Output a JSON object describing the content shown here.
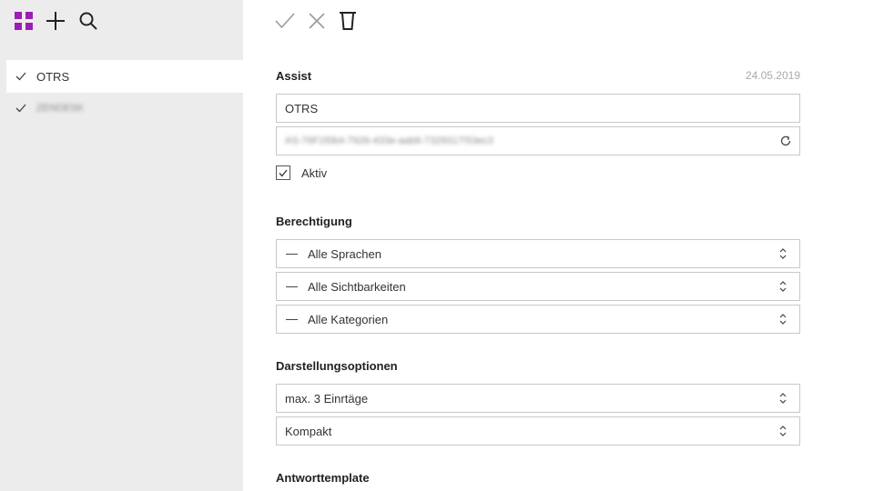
{
  "sidebar": {
    "items": [
      {
        "label": "OTRS",
        "active": true
      },
      {
        "label": "ZENDESK",
        "active": false
      }
    ]
  },
  "icons": {
    "grid": "grid-icon",
    "add": "plus-icon",
    "search": "search-icon",
    "confirm": "check-icon",
    "cancel": "close-icon",
    "delete": "trash-icon"
  },
  "colors": {
    "accent": "#9b1fb5",
    "sidebar_bg": "#ececec"
  },
  "assist": {
    "title": "Assist",
    "date": "24.05.2019",
    "name_value": "OTRS",
    "token_value": "AS-76F1f0b4-7926-433e-aab6-7329317!53ec3",
    "active_label": "Aktiv",
    "active_checked": true
  },
  "permissions": {
    "title": "Berechtigung",
    "languages": "Alle Sprachen",
    "visibilities": "Alle Sichtbarkeiten",
    "categories": "Alle Kategorien"
  },
  "display": {
    "title": "Darstellungsoptionen",
    "max_entries": "max. 3 Einrtäge",
    "layout": "Kompakt"
  },
  "template": {
    "title": "Antworttemplate"
  }
}
